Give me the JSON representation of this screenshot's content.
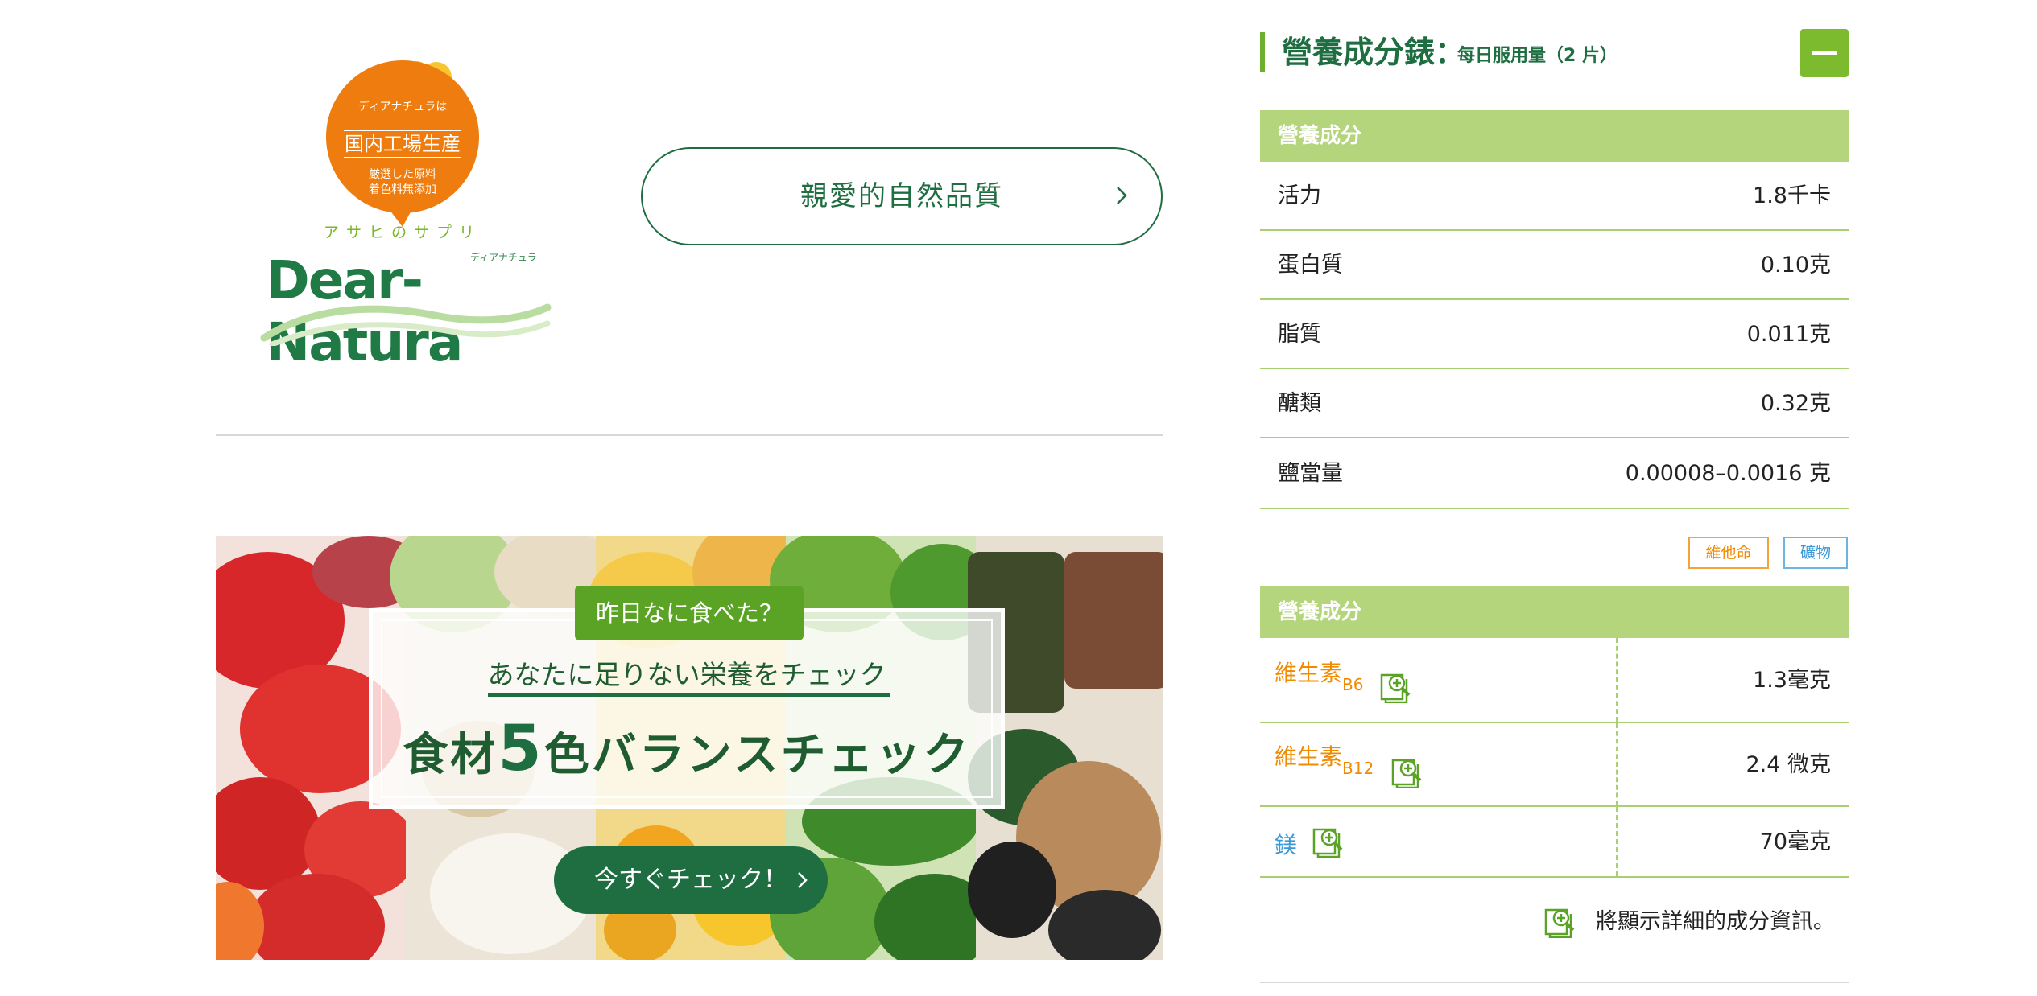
{
  "logo": {
    "bubble_pretext": "ディアナチュラは",
    "bubble_main": "国内工場生産",
    "bubble_line1": "厳選した原料",
    "bubble_line2": "着色料無添加",
    "brand_ja": "アサヒのサプリ",
    "brand_kana": "ディアナチュラ",
    "brand_name": "Dear-Natura"
  },
  "quality_button": {
    "label": "親愛的自然品質"
  },
  "banner": {
    "question": "昨日なに食べた？",
    "subheading": "あなたに足りない栄養をチェック",
    "heading_pre": "食材",
    "heading_num": "5",
    "heading_post": "色バランスチェック",
    "cta": "今すぐチェック！"
  },
  "nutrition": {
    "title": "營養成分錶：",
    "subtitle": "每日服用量（2 片）",
    "section1_header": "營養成分",
    "rows": [
      {
        "name": "活力",
        "value": "1.8千卡"
      },
      {
        "name": "蛋白質",
        "value": "0.10克"
      },
      {
        "name": "脂質",
        "value": "0.011克"
      },
      {
        "name": "醣類",
        "value": "0.32克"
      },
      {
        "name": "鹽當量",
        "value": "0.00008–0.0016 克"
      }
    ],
    "legend_vitamin": "維他命",
    "legend_mineral": "礦物",
    "section2_header": "營養成分",
    "micro_rows": [
      {
        "name": "維生素",
        "sub": "B6",
        "value": "1.3毫克",
        "kind": "vitamin"
      },
      {
        "name": "維生素",
        "sub": "B12",
        "value": "2.4 微克",
        "kind": "vitamin"
      },
      {
        "name": "鎂",
        "sub": "",
        "value": "70毫克",
        "kind": "mineral"
      }
    ],
    "note": "將顯示詳細的成分資訊。"
  },
  "colors": {
    "brand_green": "#1f6e42",
    "accent_green": "#7bbb2d",
    "header_green": "#b4d57c",
    "vitamin_orange": "#f08a00",
    "mineral_blue": "#3a98d6",
    "logo_orange": "#ee7c0e"
  },
  "icons": {
    "collapse": "minus-icon",
    "chevron": "chevron-right-icon",
    "detail": "magnify-plus-document-icon"
  }
}
